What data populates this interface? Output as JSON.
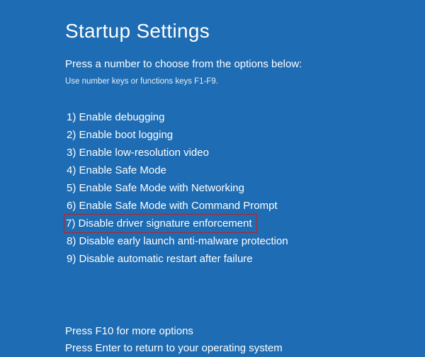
{
  "title": "Startup Settings",
  "subtitle": "Press a number to choose from the options below:",
  "hint": "Use number keys or functions keys F1-F9.",
  "options": [
    {
      "n": "1",
      "label": "Enable debugging",
      "highlight": false
    },
    {
      "n": "2",
      "label": "Enable boot logging",
      "highlight": false
    },
    {
      "n": "3",
      "label": "Enable low-resolution video",
      "highlight": false
    },
    {
      "n": "4",
      "label": "Enable Safe Mode",
      "highlight": false
    },
    {
      "n": "5",
      "label": "Enable Safe Mode with Networking",
      "highlight": false
    },
    {
      "n": "6",
      "label": "Enable Safe Mode with Command Prompt",
      "highlight": false
    },
    {
      "n": "7",
      "label": "Disable driver signature enforcement",
      "highlight": true
    },
    {
      "n": "8",
      "label": "Disable early launch anti-malware protection",
      "highlight": false
    },
    {
      "n": "9",
      "label": "Disable automatic restart after failure",
      "highlight": false
    }
  ],
  "footer": {
    "more": "Press F10 for more options",
    "return": "Press Enter to return to your operating system"
  }
}
